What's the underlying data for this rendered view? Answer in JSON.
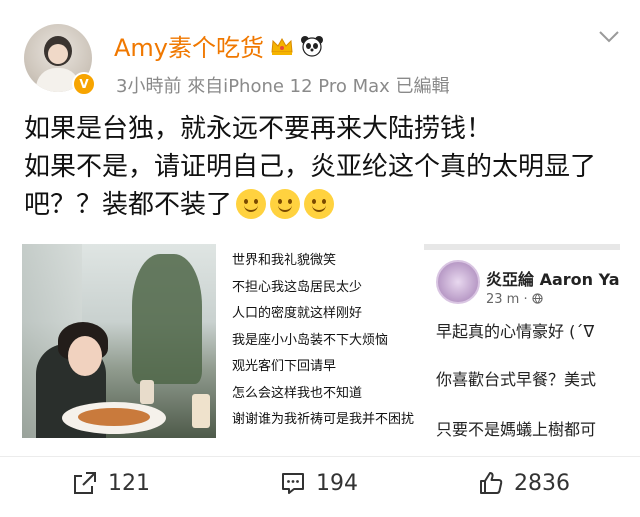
{
  "user": {
    "name": "Amy素个吃货",
    "verified_mark": "V",
    "badges": [
      "crown-badge-icon",
      "panda-emoji-icon"
    ]
  },
  "meta": {
    "time": "3小時前",
    "source": "來自iPhone 12 Pro Max",
    "edited": "已編輯"
  },
  "post": {
    "text": "如果是台独，就永远不要再来大陆捞钱！\n如果不是，请证明自己，炎亚纶这个真的太明显了吧？？装都不装了",
    "emojis": [
      "smile-emoji-icon",
      "smile-emoji-icon",
      "smile-emoji-icon"
    ]
  },
  "images": {
    "poem_lines": [
      "世界和我礼貌微笑",
      "不担心我这岛居民太少",
      "人口的密度就这样刚好",
      "我是座小小岛装不下大烦恼",
      "观光客们下回请早",
      "怎么会这样我也不知道",
      "谢谢谁为我祈祷可是我并不困扰"
    ],
    "screenshot": {
      "name": "炎亞綸 Aaron Ya",
      "time": "23 m · ",
      "lines": [
        "早起真的心情豪好 (´ᐁ",
        "你喜歡台式早餐？美式",
        "只要不是媽蟻上樹都可"
      ]
    }
  },
  "actions": {
    "repost": "121",
    "comment": "194",
    "like": "2836"
  },
  "colors": {
    "username": "#f07800",
    "meta": "#8a8a8a",
    "verified": "#f7a400"
  }
}
